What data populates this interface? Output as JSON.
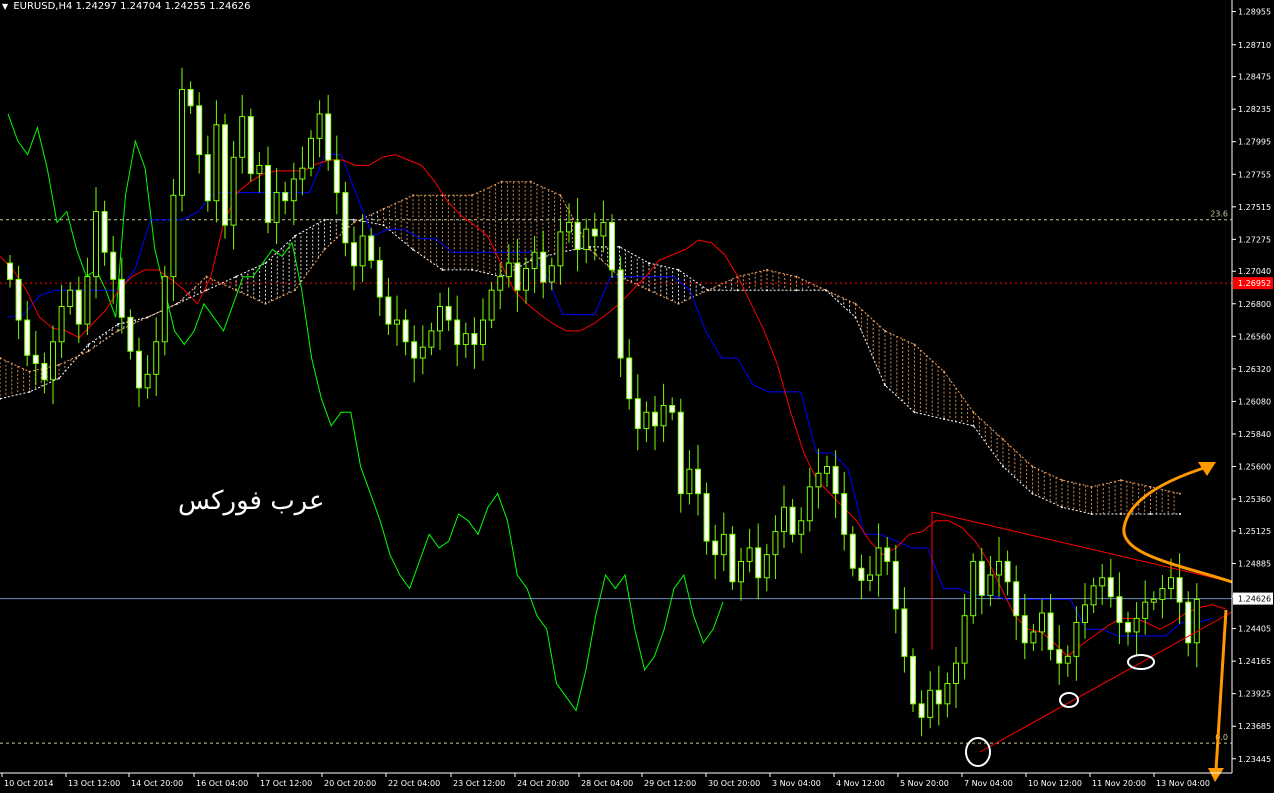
{
  "header": {
    "symbol": "EURUSD,H4",
    "ohlc": "1.24297 1.24704 1.24255 1.24626"
  },
  "watermark": "عرب فوركس",
  "colors": {
    "background": "#000000",
    "candle": "#ffffff",
    "candle_outline": "#7cfc00",
    "tenkan": "#ff0000",
    "kijun": "#0000ff",
    "chikou": "#00ff00",
    "cloud_a": "#f4a460",
    "cloud_b": "#ffffff",
    "annotation": "#ff9900",
    "triangle": "#ff0000",
    "price_line": "#6f8fbf",
    "level_red": "#ff0000"
  },
  "chart_data": {
    "type": "candlestick",
    "symbol": "EURUSD",
    "timeframe": "H4",
    "ylim": [
      1.2334,
      1.2904
    ],
    "y_ticks": [
      "1.28955",
      "1.28710",
      "1.28475",
      "1.28235",
      "1.27995",
      "1.27755",
      "1.27515",
      "1.27275",
      "1.27040",
      "1.26800",
      "1.26560",
      "1.26320",
      "1.26080",
      "1.25840",
      "1.25600",
      "1.25360",
      "1.25125",
      "1.24885",
      "1.24645",
      "1.24405",
      "1.24165",
      "1.23925",
      "1.23685",
      "1.23445"
    ],
    "x_ticks": [
      "10 Oct 2014",
      "13 Oct 12:00",
      "14 Oct 20:00",
      "16 Oct 04:00",
      "17 Oct 12:00",
      "20 Oct 20:00",
      "22 Oct 04:00",
      "23 Oct 12:00",
      "24 Oct 20:00",
      "28 Oct 04:00",
      "29 Oct 12:00",
      "30 Oct 20:00",
      "3 Nov 04:00",
      "4 Nov 12:00",
      "5 Nov 20:00",
      "7 Nov 04:00",
      "10 Nov 12:00",
      "11 Nov 20:00",
      "13 Nov 04:00"
    ],
    "current_price": 1.24626,
    "current_price_label": "1.24626",
    "red_level": 1.26952,
    "red_level_label": "1.26952",
    "fibo_levels": [
      {
        "label": "23.6",
        "value": 1.2742
      },
      {
        "label": "0.0",
        "value": 1.2356
      }
    ],
    "closes": [
      1.2698,
      1.2668,
      1.2642,
      1.2636,
      1.2624,
      1.2652,
      1.2678,
      1.269,
      1.2665,
      1.27,
      1.2748,
      1.2718,
      1.2698,
      1.267,
      1.2645,
      1.2618,
      1.2628,
      1.2652,
      1.27,
      1.276,
      1.2838,
      1.2826,
      1.279,
      1.2756,
      1.2812,
      1.2738,
      1.2788,
      1.2818,
      1.2776,
      1.2782,
      1.274,
      1.2762,
      1.2756,
      1.2772,
      1.278,
      1.2802,
      1.282,
      1.2786,
      1.2762,
      1.2725,
      1.2708,
      1.273,
      1.2712,
      1.2685,
      1.2665,
      1.2668,
      1.2652,
      1.264,
      1.2648,
      1.266,
      1.2678,
      1.2668,
      1.265,
      1.2658,
      1.265,
      1.2668,
      1.269,
      1.27,
      1.271,
      1.269,
      1.2706,
      1.2718,
      1.2696,
      1.2708,
      1.2733,
      1.274,
      1.272,
      1.2735,
      1.273,
      1.274,
      1.2705,
      1.264,
      1.261,
      1.2588,
      1.26,
      1.259,
      1.2605,
      1.26,
      1.254,
      1.2558,
      1.254,
      1.2505,
      1.2495,
      1.251,
      1.2475,
      1.249,
      1.25,
      1.2478,
      1.2495,
      1.2512,
      1.253,
      1.251,
      1.252,
      1.2545,
      1.2555,
      1.256,
      1.254,
      1.251,
      1.2485,
      1.2476,
      1.248,
      1.25,
      1.249,
      1.2455,
      1.242,
      1.2385,
      1.2375,
      1.2395,
      1.2385,
      1.24,
      1.2415,
      1.245,
      1.249,
      1.2465,
      1.248,
      1.249,
      1.2475,
      1.245,
      1.243,
      1.2438,
      1.2452,
      1.2425,
      1.2415,
      1.242,
      1.2445,
      1.2458,
      1.2472,
      1.2478,
      1.2464,
      1.2445,
      1.2438,
      1.2448,
      1.246,
      1.2462,
      1.247,
      1.2478,
      1.246,
      1.243,
      1.2462
    ],
    "tenkan": [
      1.2715,
      1.2705,
      1.269,
      1.267,
      1.2662,
      1.266,
      1.2655,
      1.2665,
      1.2675,
      1.269,
      1.27,
      1.2705,
      1.2705,
      1.2698,
      1.269,
      1.268,
      1.27,
      1.274,
      1.2762,
      1.277,
      1.2776,
      1.2778,
      1.2778,
      1.2778,
      1.2783,
      1.2786,
      1.2786,
      1.2782,
      1.2782,
      1.2788,
      1.279,
      1.2786,
      1.2782,
      1.277,
      1.2755,
      1.2745,
      1.2738,
      1.273,
      1.271,
      1.269,
      1.268,
      1.2672,
      1.2665,
      1.266,
      1.266,
      1.2665,
      1.2672,
      1.268,
      1.269,
      1.27,
      1.2712,
      1.2716,
      1.272,
      1.2727,
      1.2725,
      1.2716,
      1.27,
      1.268,
      1.266,
      1.2635,
      1.26,
      1.257,
      1.255,
      1.254,
      1.253,
      1.252,
      1.2505,
      1.2495,
      1.25,
      1.251,
      1.2512,
      1.252,
      1.252,
      1.2515,
      1.2505,
      1.249,
      1.247,
      1.245,
      1.244,
      1.2438,
      1.243,
      1.242,
      1.2428,
      1.2435,
      1.2442,
      1.2448,
      1.2448,
      1.2445,
      1.244,
      1.2445,
      1.2452,
      1.2456,
      1.2458,
      1.2455
    ],
    "kijun": [
      1.267,
      1.2672,
      1.2686,
      1.269,
      1.269,
      1.269,
      1.269,
      1.269,
      1.2705,
      1.2742,
      1.2742,
      1.2742,
      1.2748,
      1.2762,
      1.2762,
      1.2762,
      1.2762,
      1.2762,
      1.2762,
      1.2762,
      1.279,
      1.279,
      1.276,
      1.273,
      1.2735,
      1.2735,
      1.2728,
      1.2728,
      1.2718,
      1.2718,
      1.2718,
      1.2718,
      1.2718,
      1.2718,
      1.27,
      1.2672,
      1.2672,
      1.2672,
      1.27,
      1.27,
      1.27,
      1.27,
      1.27,
      1.269,
      1.266,
      1.264,
      1.264,
      1.262,
      1.2615,
      1.2615,
      1.2615,
      1.257,
      1.257,
      1.2558,
      1.251,
      1.251,
      1.2505,
      1.25,
      1.25,
      1.247,
      1.247,
      1.2465,
      1.2465,
      1.2462,
      1.2462,
      1.2462,
      1.2462,
      1.2462,
      1.244,
      1.244,
      1.2435,
      1.2435,
      1.2435,
      1.2435,
      1.2445,
      1.2445,
      1.2448
    ],
    "chikou": [
      1.282,
      1.28,
      1.279,
      1.281,
      1.278,
      1.274,
      1.2748,
      1.272,
      1.27,
      1.2705,
      1.269,
      1.267,
      1.276,
      1.28,
      1.278,
      1.272,
      1.269,
      1.266,
      1.265,
      1.266,
      1.268,
      1.267,
      1.266,
      1.268,
      1.27,
      1.27,
      1.271,
      1.272,
      1.2715,
      1.2725,
      1.269,
      1.264,
      1.261,
      1.259,
      1.26,
      1.26,
      1.256,
      1.254,
      1.252,
      1.2495,
      1.248,
      1.247,
      1.249,
      1.251,
      1.25,
      1.2505,
      1.2525,
      1.252,
      1.251,
      1.253,
      1.254,
      1.252,
      1.248,
      1.247,
      1.245,
      1.244,
      1.24,
      1.239,
      1.238,
      1.241,
      1.245,
      1.248,
      1.247,
      1.248,
      1.244,
      1.241,
      1.242,
      1.244,
      1.247,
      1.248,
      1.245,
      1.243,
      1.244,
      1.246
    ],
    "senkou_a": [
      1.264,
      1.263,
      1.2635,
      1.2645,
      1.266,
      1.267,
      1.268,
      1.27,
      1.269,
      1.268,
      1.269,
      1.272,
      1.274,
      1.275,
      1.276,
      1.276,
      1.276,
      1.277,
      1.277,
      1.276,
      1.272,
      1.27,
      1.269,
      1.268,
      1.269,
      1.27,
      1.2705,
      1.27,
      1.269,
      1.268,
      1.266,
      1.265,
      1.263,
      1.26,
      1.258,
      1.256,
      1.255,
      1.2545,
      1.255,
      1.2545,
      1.254
    ],
    "senkou_b": [
      1.261,
      1.2615,
      1.2625,
      1.265,
      1.2665,
      1.267,
      1.268,
      1.269,
      1.27,
      1.271,
      1.273,
      1.2742,
      1.2742,
      1.2738,
      1.272,
      1.2705,
      1.2705,
      1.27,
      1.2712,
      1.2718,
      1.2722,
      1.2722,
      1.271,
      1.2705,
      1.269,
      1.269,
      1.269,
      1.269,
      1.269,
      1.267,
      1.262,
      1.26,
      1.2595,
      1.259,
      1.256,
      1.254,
      1.253,
      1.2525,
      1.2525,
      1.2525,
      1.2525
    ]
  }
}
